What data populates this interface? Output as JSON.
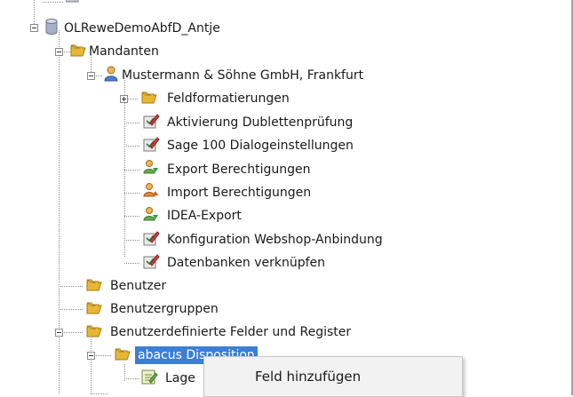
{
  "tree": {
    "db_label": "OLReweDemoAbfD_Antje",
    "mandanten_label": "Mandanten",
    "company_label": "Mustermann & Söhne GmbH, Frankfurt",
    "items": [
      {
        "label": "Feldformatierungen",
        "icon": "folder-icon"
      },
      {
        "label": "Aktivierung Dublettenprüfung",
        "icon": "pencil-check-icon"
      },
      {
        "label": "Sage 100 Dialogeinstellungen",
        "icon": "pencil-check-icon"
      },
      {
        "label": "Export Berechtigungen",
        "icon": "users-export-icon"
      },
      {
        "label": "Import Berechtigungen",
        "icon": "users-import-icon"
      },
      {
        "label": "IDEA-Export",
        "icon": "users-export-icon"
      },
      {
        "label": "Konfiguration Webshop-Anbindung",
        "icon": "pencil-check-icon"
      },
      {
        "label": "Datenbanken verknüpfen",
        "icon": "pencil-check-icon"
      }
    ],
    "benutzer_label": "Benutzer",
    "benutzergruppen_label": "Benutzergruppen",
    "udf_label": "Benutzerdefinierte Felder und Register",
    "abacus_label": "abacus Disposition",
    "lager_label": "Lage"
  },
  "context_menu": {
    "add_field_label": "Feld hinzufügen"
  },
  "colors": {
    "selection": "#3b7fd6",
    "folder": "#f2c94c"
  }
}
